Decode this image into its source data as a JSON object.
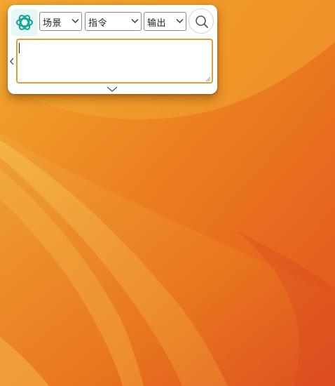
{
  "wallpaper": {
    "name": "orange-wave-wallpaper",
    "colors": {
      "top": "#f2a22c",
      "middle": "#ec7f1e",
      "bottom": "#e35a22",
      "highlight": "#f6bd4a"
    }
  },
  "panel": {
    "logo_icon": "chatgpt-logo-icon",
    "selects": {
      "scene": "场景",
      "command": "指令",
      "output": "输出"
    },
    "search_icon": "search-icon",
    "collapse_icon": "chevron-left-icon",
    "expand_icon": "chevron-down-icon",
    "textarea": {
      "value": "",
      "placeholder": ""
    },
    "accent_color": "#d8a23a",
    "logo_bg": "#e6f8f6",
    "logo_color": "#10a393"
  }
}
